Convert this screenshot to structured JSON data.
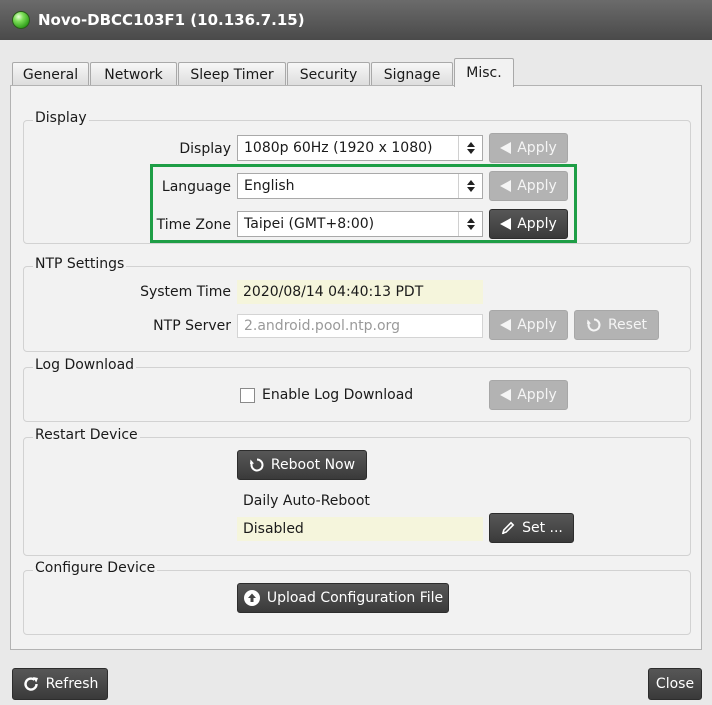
{
  "window": {
    "title": "Novo-DBCC103F1 (10.136.7.15)"
  },
  "tabs": [
    {
      "label": "General"
    },
    {
      "label": "Network"
    },
    {
      "label": "Sleep Timer"
    },
    {
      "label": "Security"
    },
    {
      "label": "Signage"
    },
    {
      "label": "Misc.",
      "active": true
    }
  ],
  "display_group": {
    "legend": "Display",
    "display": {
      "label": "Display",
      "value": "1080p 60Hz (1920 x 1080)",
      "apply_label": "Apply"
    },
    "language": {
      "label": "Language",
      "value": "English",
      "apply_label": "Apply"
    },
    "timezone": {
      "label": "Time Zone",
      "value": "Taipei (GMT+8:00)",
      "apply_label": "Apply"
    }
  },
  "ntp_group": {
    "legend": "NTP Settings",
    "system_time_label": "System Time",
    "system_time_value": "2020/08/14 04:40:13 PDT",
    "ntp_server_label": "NTP Server",
    "ntp_server_placeholder": "2.android.pool.ntp.org",
    "apply_label": "Apply",
    "reset_label": "Reset"
  },
  "log_group": {
    "legend": "Log Download",
    "checkbox_label": "Enable Log Download",
    "apply_label": "Apply"
  },
  "restart_group": {
    "legend": "Restart Device",
    "reboot_label": "Reboot Now",
    "auto_reboot_label": "Daily Auto-Reboot",
    "auto_reboot_value": "Disabled",
    "set_label": "Set ..."
  },
  "config_group": {
    "legend": "Configure Device",
    "upload_label": "Upload Configuration File"
  },
  "footer": {
    "refresh_label": "Refresh",
    "close_label": "Close"
  },
  "colors": {
    "highlight": "#1e9e46",
    "status_led": "#3cc020",
    "readonly_field": "#f5f5dc"
  }
}
